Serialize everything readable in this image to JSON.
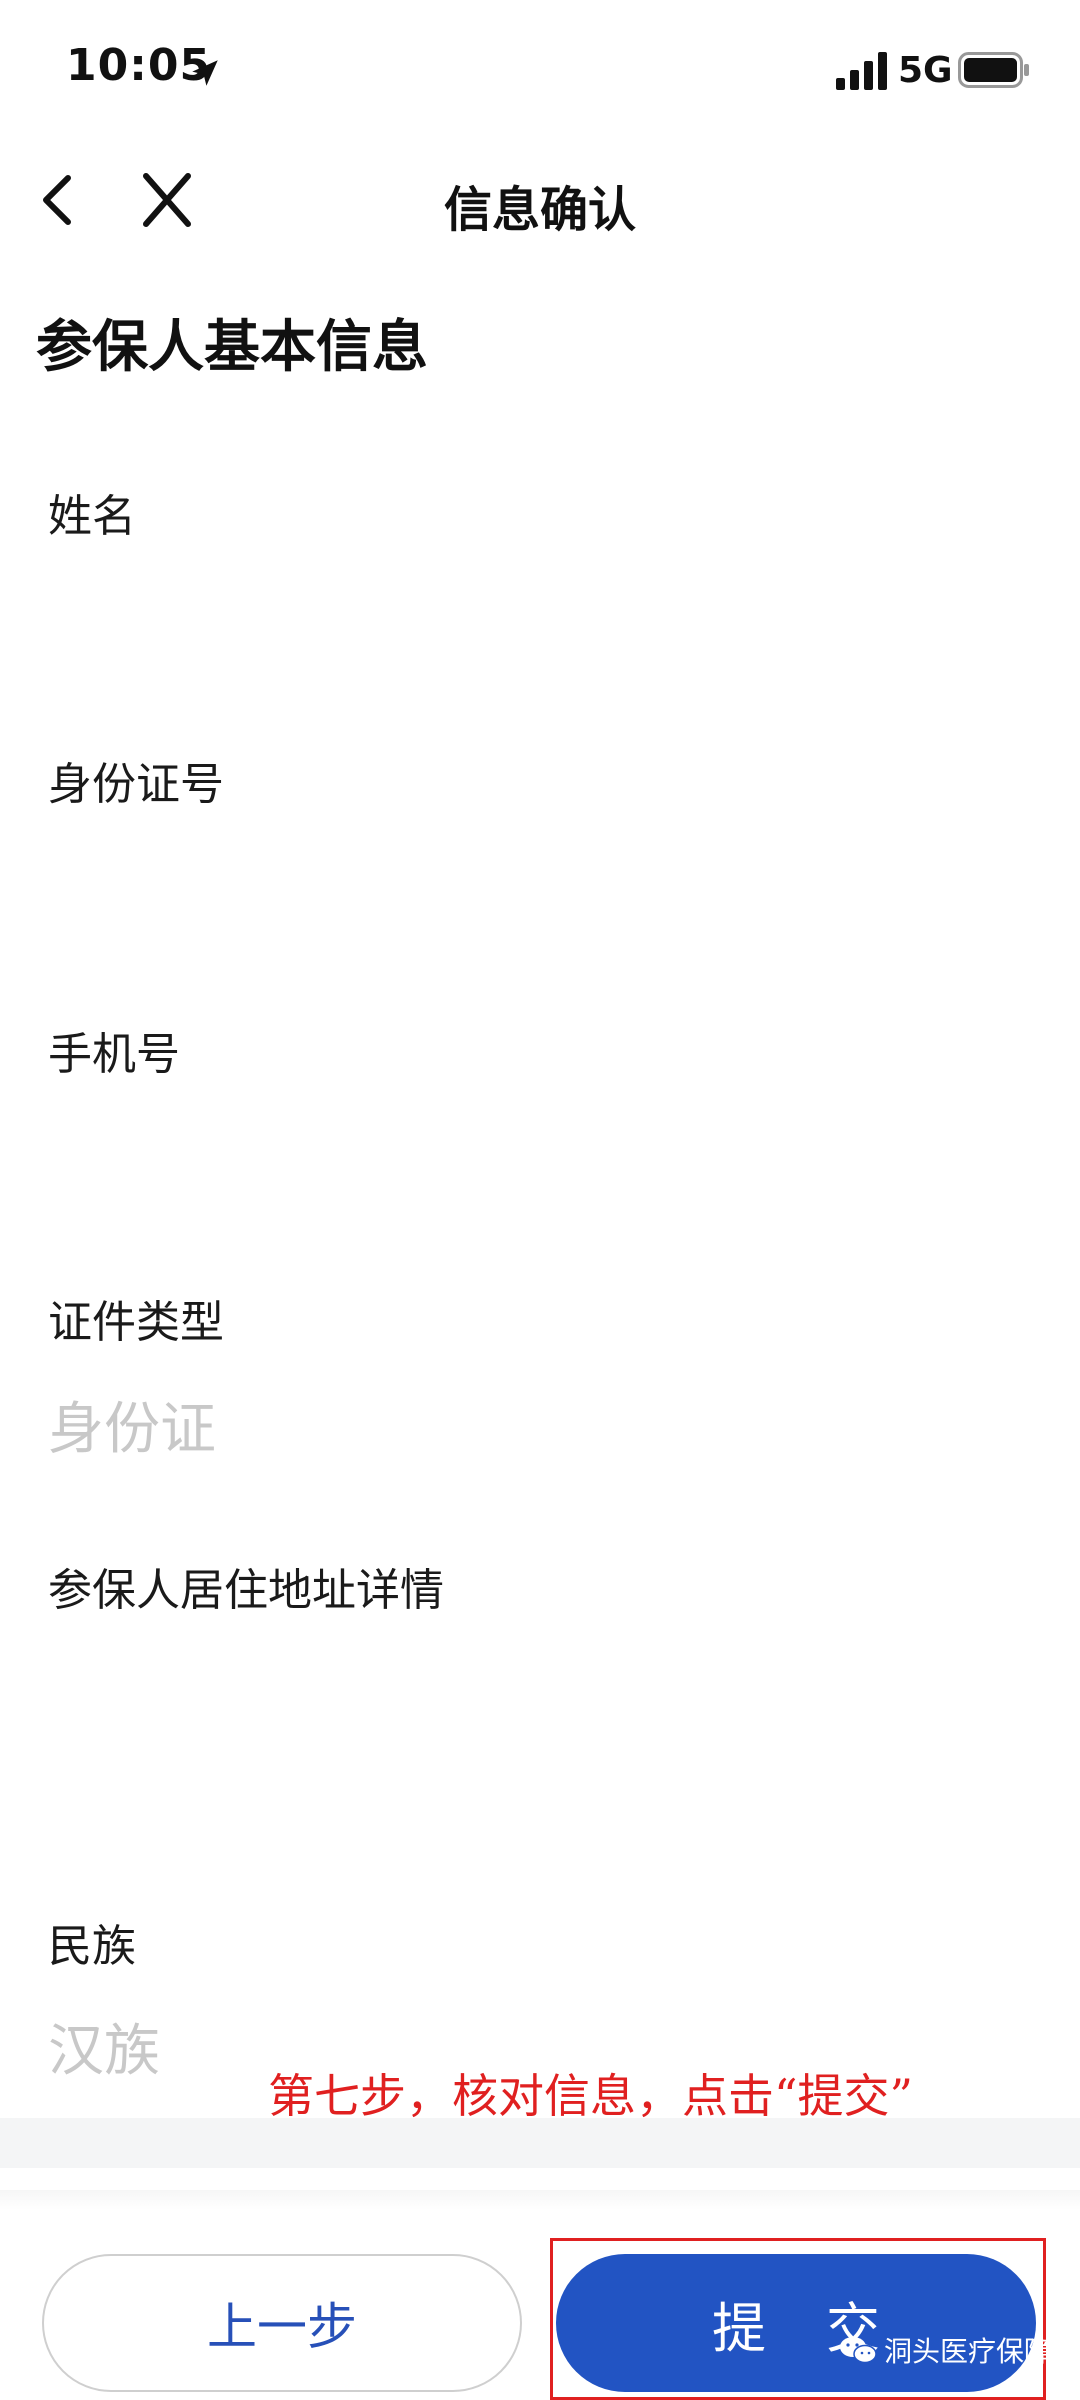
{
  "status_bar": {
    "time": "10:05",
    "network": "5G",
    "icons": [
      "location-arrow-icon",
      "signal-icon",
      "battery-icon"
    ]
  },
  "nav": {
    "title": "信息确认",
    "icons": [
      "back-chevron-icon",
      "close-icon"
    ]
  },
  "section_title": "参保人基本信息",
  "fields": [
    {
      "label": "姓名",
      "value": ""
    },
    {
      "label": "身份证号",
      "value": ""
    },
    {
      "label": "手机号",
      "value": ""
    },
    {
      "label": "证件类型",
      "value": "身份证"
    },
    {
      "label": "参保人居住地址详情",
      "value": ""
    },
    {
      "label": "民族",
      "value": "汉族"
    }
  ],
  "annotation": "第七步，核对信息，点击“提交”",
  "buttons": {
    "prev": "上一步",
    "submit": "提交"
  },
  "watermark": "洞头医疗保障",
  "colors": {
    "primary": "#2254c3",
    "annotation_red": "#e02020",
    "value_gray": "#c8c8c8",
    "prev_text": "#2750b8"
  }
}
